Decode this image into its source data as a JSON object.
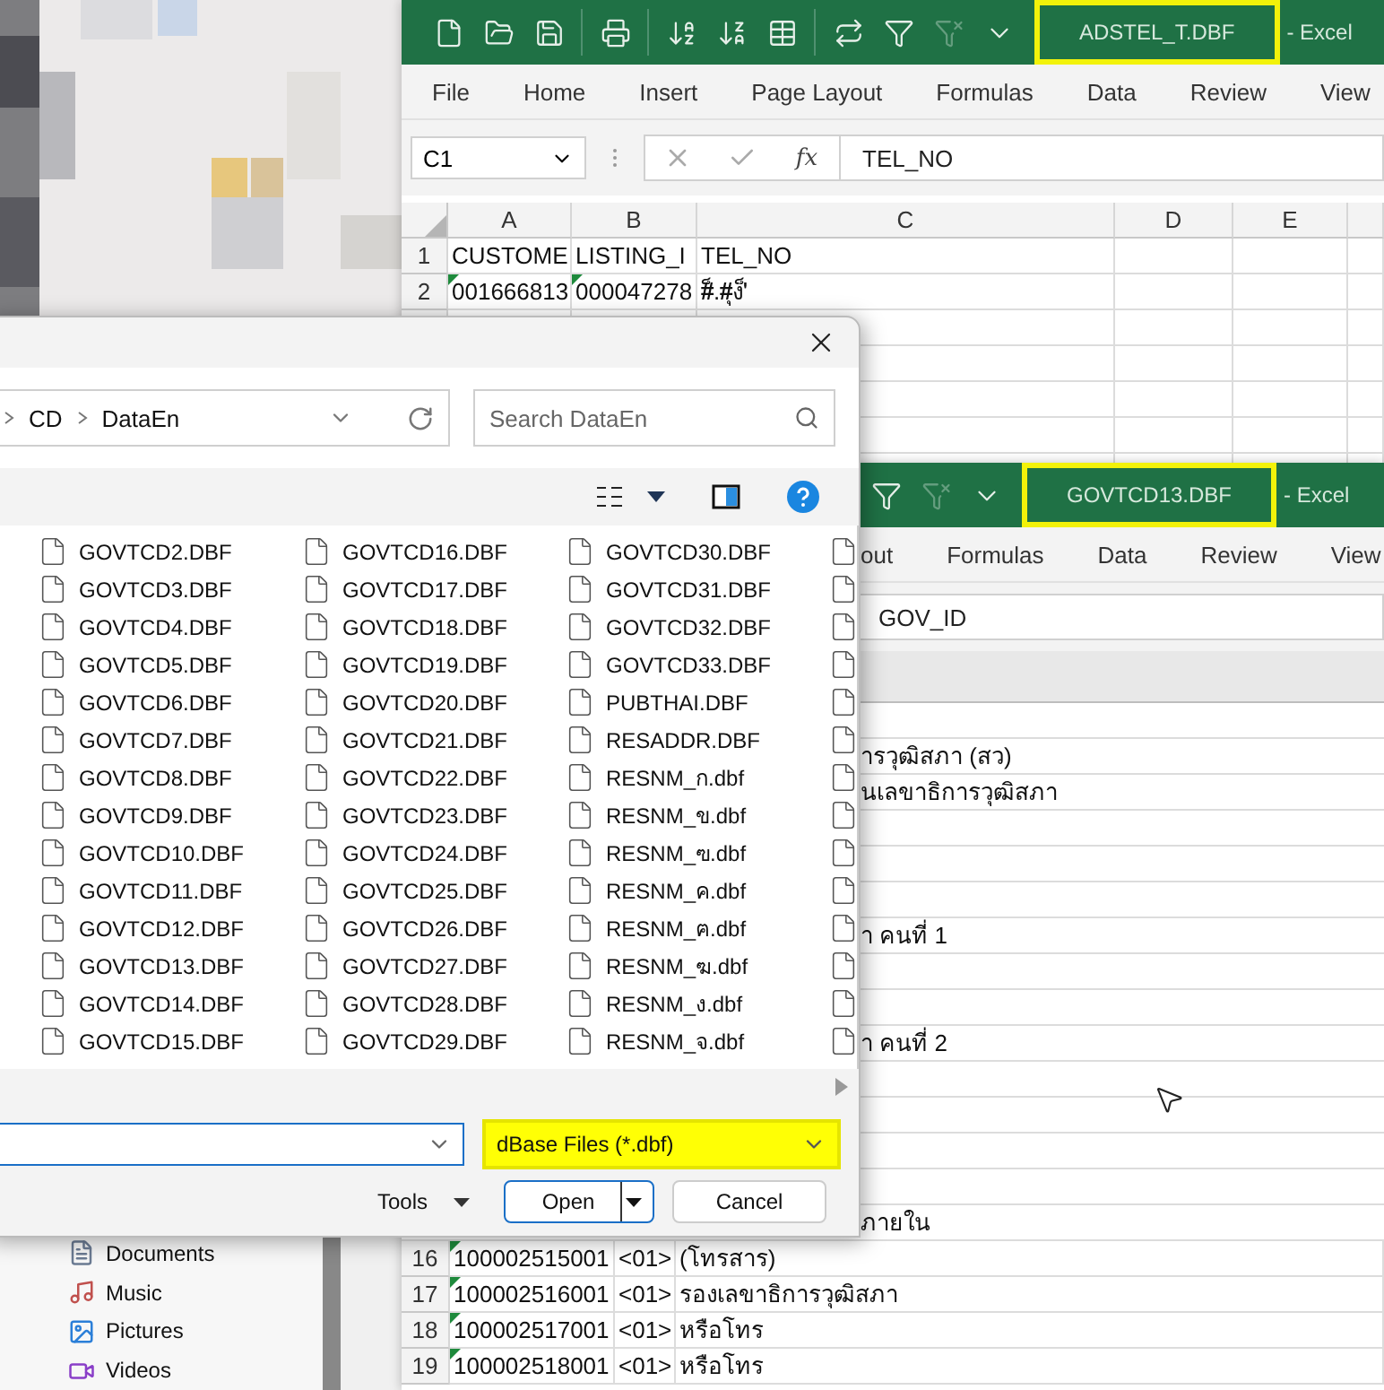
{
  "excel_back": {
    "title": "ADSTEL_T.DBF",
    "app": "- Excel",
    "title_highlighted": true,
    "ribbon_tabs": [
      "File",
      "Home",
      "Insert",
      "Page Layout",
      "Formulas",
      "Data",
      "Review",
      "View"
    ],
    "name_box": "C1",
    "function_label": "fx",
    "formula": "TEL_NO",
    "columns": [
      "A",
      "B",
      "C",
      "D",
      "E"
    ],
    "rows": [
      {
        "number": "1",
        "cells": [
          "CUSTOME",
          "LISTING_I",
          "TEL_NO"
        ]
      },
      {
        "number": "2",
        "cells": [
          "001666813",
          "000047278",
          "#็.#ุง'็"
        ]
      }
    ]
  },
  "excel_front": {
    "title": "GOVTCD13.DBF",
    "app": "- Excel",
    "title_highlighted": true,
    "ribbon_tabs": [
      "out",
      "Formulas",
      "Data",
      "Review",
      "View"
    ],
    "formula": "GOV_ID",
    "covered_rows": [
      {},
      {
        "text": "ารวุฒิสภา (สว)"
      },
      {
        "text": "นเลขาธิการวุฒิสภา"
      },
      {},
      {},
      {},
      {
        "text": "า คนที่ 1"
      },
      {},
      {},
      {
        "text": "า คนที่ 2"
      },
      {},
      {},
      {},
      {},
      {
        "text": "ภายใน"
      }
    ],
    "rows": [
      {
        "number": "16",
        "cells": [
          "100002515001",
          "<01>",
          "(โทรสาร)"
        ]
      },
      {
        "number": "17",
        "cells": [
          "100002516001",
          "<01>",
          "รองเลขาธิการวุฒิสภา"
        ]
      },
      {
        "number": "18",
        "cells": [
          "100002517001",
          "<01>",
          "หรือโทร"
        ]
      },
      {
        "number": "19",
        "cells": [
          "100002518001",
          "<01>",
          "หรือโทร"
        ]
      }
    ]
  },
  "nav_pane": [
    {
      "label": "Documents",
      "kind": "documents"
    },
    {
      "label": "Music",
      "kind": "music"
    },
    {
      "label": "Pictures",
      "kind": "pictures"
    },
    {
      "label": "Videos",
      "kind": "videos"
    }
  ],
  "open_dialog": {
    "breadcrumb": [
      "CD",
      "DataEn"
    ],
    "search": {
      "placeholder": "Search DataEn"
    },
    "file_columns": [
      [
        "GOVTCD2.DBF",
        "GOVTCD3.DBF",
        "GOVTCD4.DBF",
        "GOVTCD5.DBF",
        "GOVTCD6.DBF",
        "GOVTCD7.DBF",
        "GOVTCD8.DBF",
        "GOVTCD9.DBF",
        "GOVTCD10.DBF",
        "GOVTCD11.DBF",
        "GOVTCD12.DBF",
        "GOVTCD13.DBF",
        "GOVTCD14.DBF",
        "GOVTCD15.DBF"
      ],
      [
        "GOVTCD16.DBF",
        "GOVTCD17.DBF",
        "GOVTCD18.DBF",
        "GOVTCD19.DBF",
        "GOVTCD20.DBF",
        "GOVTCD21.DBF",
        "GOVTCD22.DBF",
        "GOVTCD23.DBF",
        "GOVTCD24.DBF",
        "GOVTCD25.DBF",
        "GOVTCD26.DBF",
        "GOVTCD27.DBF",
        "GOVTCD28.DBF",
        "GOVTCD29.DBF"
      ],
      [
        "GOVTCD30.DBF",
        "GOVTCD31.DBF",
        "GOVTCD32.DBF",
        "GOVTCD33.DBF",
        "PUBTHAI.DBF",
        "RESADDR.DBF",
        "RESNM_ก.dbf",
        "RESNM_ข.dbf",
        "RESNM_ฃ.dbf",
        "RESNM_ค.dbf",
        "RESNM_ฅ.dbf",
        "RESNM_ฆ.dbf",
        "RESNM_ง.dbf",
        "RESNM_จ.dbf"
      ]
    ],
    "file_type": "dBase Files (*.dbf)",
    "file_type_highlighted": true,
    "buttons": [
      {
        "label": "Tools",
        "kind": "menu"
      },
      {
        "label": "Open",
        "kind": "split"
      },
      {
        "label": "Cancel",
        "kind": "plain"
      }
    ]
  }
}
